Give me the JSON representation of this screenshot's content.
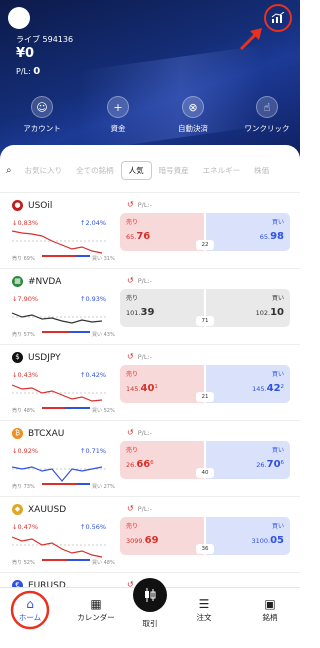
{
  "header": {
    "account": "ライブ 594136",
    "balance": "¥0",
    "pl_label": "P/L:",
    "pl_value": "0"
  },
  "quick_actions": [
    {
      "label": "アカウント",
      "icon": "person-icon"
    },
    {
      "label": "資金",
      "icon": "plus-icon"
    },
    {
      "label": "自動決済",
      "icon": "close-circle-icon"
    },
    {
      "label": "ワンクリック",
      "icon": "tap-icon"
    }
  ],
  "tabs": [
    "お気に入り",
    "全ての銘柄",
    "人気",
    "暗号資産",
    "エネルギー",
    "株価"
  ],
  "selected_tab": "人気",
  "instruments": [
    {
      "symbol": "USOil",
      "change_down": "0.83%",
      "change_up": "2.04%",
      "sell_pct": "69%",
      "buy_pct": "31%",
      "sent_sell": "売り",
      "sent_buy": "買い",
      "pnl": "P/L:-",
      "sell_label": "売り",
      "buy_label": "買い",
      "sell_main": "65.",
      "sell_big": "76",
      "buy_main": "65.",
      "buy_big": "98",
      "spread": "22",
      "mode": "color"
    },
    {
      "symbol": "#NVDA",
      "change_down": "7.90%",
      "change_up": "0.93%",
      "sell_pct": "57%",
      "buy_pct": "43%",
      "sent_sell": "売り",
      "sent_buy": "買い",
      "pnl": "P/L:-",
      "sell_label": "売り",
      "buy_label": "買い",
      "sell_main": "101.",
      "sell_big": "39",
      "buy_main": "102.",
      "buy_big": "10",
      "spread": "71",
      "mode": "gray"
    },
    {
      "symbol": "USDJPY",
      "change_down": "0.43%",
      "change_up": "0.42%",
      "sell_pct": "48%",
      "buy_pct": "52%",
      "sent_sell": "売り",
      "sent_buy": "買い",
      "pnl": "P/L:-",
      "sell_label": "売り",
      "buy_label": "買い",
      "sell_main": "145.",
      "sell_big": "40",
      "sell_sup": "1",
      "buy_main": "145.",
      "buy_big": "42",
      "buy_sup": "2",
      "spread": "21",
      "mode": "color"
    },
    {
      "symbol": "BTCXAU",
      "change_down": "0.92%",
      "change_up": "0.71%",
      "sell_pct": "73%",
      "buy_pct": "27%",
      "sent_sell": "売り",
      "sent_buy": "買い",
      "pnl": "P/L:-",
      "sell_label": "売り",
      "buy_label": "買い",
      "sell_main": "26.",
      "sell_big": "66",
      "sell_sup": "6",
      "buy_main": "26.",
      "buy_big": "70",
      "buy_sup": "6",
      "spread": "40",
      "mode": "color"
    },
    {
      "symbol": "XAUUSD",
      "change_down": "0.47%",
      "change_up": "0.56%",
      "sell_pct": "52%",
      "buy_pct": "48%",
      "sent_sell": "売り",
      "sent_buy": "買い",
      "pnl": "P/L:-",
      "sell_label": "売り",
      "buy_label": "買い",
      "sell_main": "3099.",
      "sell_big": "69",
      "buy_main": "3100.",
      "buy_big": "05",
      "spread": "36",
      "mode": "color"
    },
    {
      "symbol": "EURUSD",
      "pnl": "P/L:-"
    }
  ],
  "bottom_nav": [
    {
      "label": "ホーム",
      "icon": "home-icon"
    },
    {
      "label": "カレンダー",
      "icon": "calendar-icon"
    },
    {
      "label": "取引",
      "icon": "candlestick-icon"
    },
    {
      "label": "注文",
      "icon": "order-list-icon"
    },
    {
      "label": "銘柄",
      "icon": "wallet-icon"
    }
  ],
  "colors": {
    "sell_bg": "#f8d9d9",
    "buy_bg": "#d9e1fb",
    "sell_text": "#d9302b",
    "buy_text": "#2f52e0",
    "annotation": "#e8311e"
  }
}
